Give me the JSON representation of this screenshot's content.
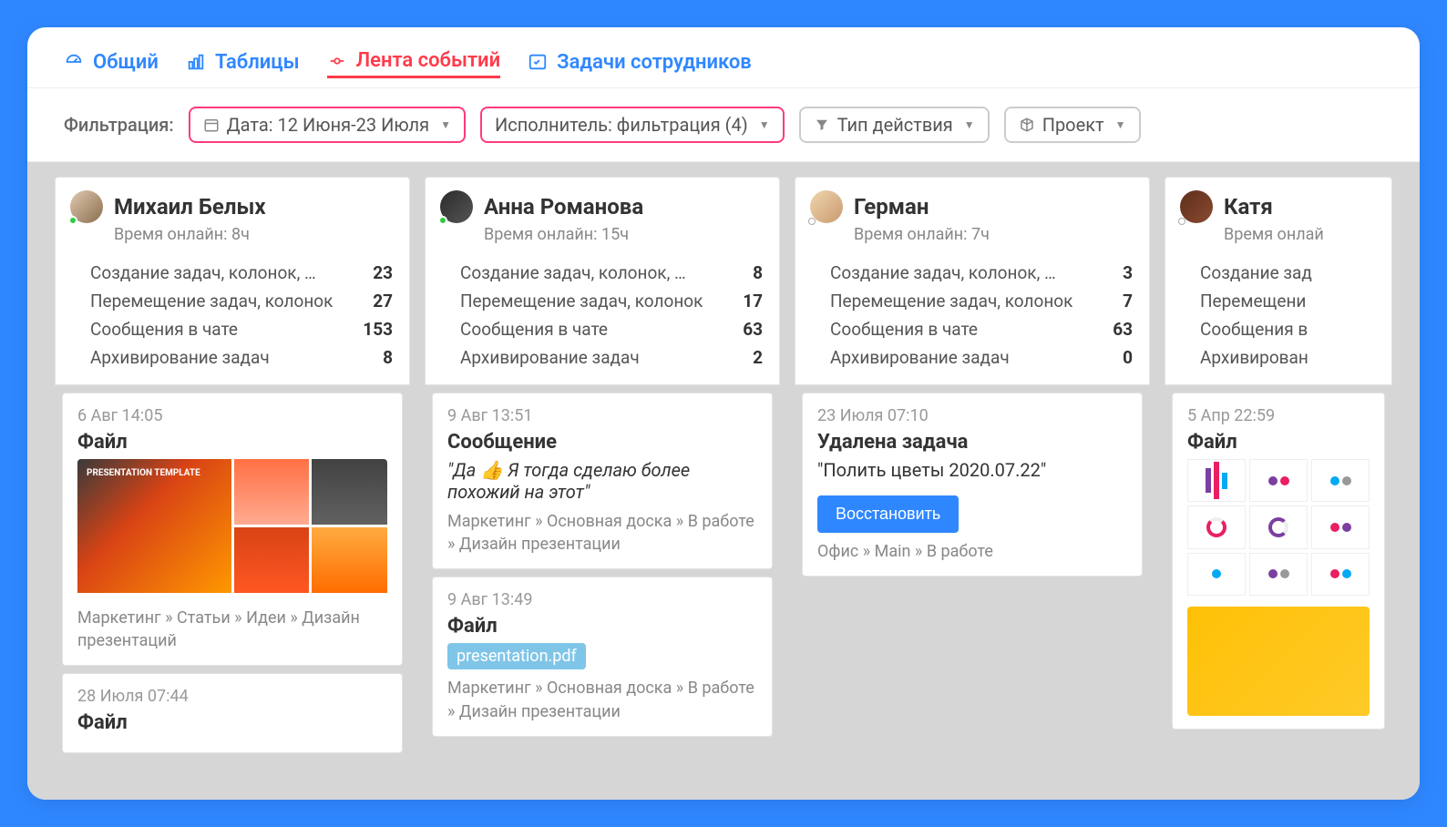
{
  "tabs": {
    "general": "Общий",
    "tables": "Таблицы",
    "feed": "Лента событий",
    "tasks": "Задачи сотрудников"
  },
  "filter": {
    "label": "Фильтрация:",
    "date": "Дата: 12 Июня-23 Июля",
    "assignee": "Исполнитель: фильтрация (4)",
    "action_type": "Тип действия",
    "project": "Проект"
  },
  "columns": [
    {
      "name": "Михаил Белых",
      "online": "Время онлайн: 8ч",
      "status": "online",
      "stats": [
        {
          "label": "Создание задач, колонок, …",
          "value": "23"
        },
        {
          "label": "Перемещение задач, колонок",
          "value": "27"
        },
        {
          "label": "Сообщения в чате",
          "value": "153"
        },
        {
          "label": "Архивирование задач",
          "value": "8"
        }
      ],
      "cards": [
        {
          "time": "6 Авг 14:05",
          "title": "Файл",
          "thumb": "orange",
          "path": "Маркетинг » Статьи » Идеи » Дизайн презентаций"
        },
        {
          "time": "28 Июля 07:44",
          "title": "Файл"
        }
      ]
    },
    {
      "name": "Анна Романова",
      "online": "Время онлайн: 15ч",
      "status": "online",
      "stats": [
        {
          "label": "Создание задач, колонок, …",
          "value": "8"
        },
        {
          "label": "Перемещение задач, колонок",
          "value": "17"
        },
        {
          "label": "Сообщения в чате",
          "value": "63"
        },
        {
          "label": "Архивирование задач",
          "value": "2"
        }
      ],
      "cards": [
        {
          "time": "9 Авг 13:51",
          "title": "Сообщение",
          "quote": "\"Да 👍  Я тогда сделаю более похожий на этот\"",
          "path": "Маркетинг » Основная доска » В работе » Дизайн презентации"
        },
        {
          "time": "9 Авг 13:49",
          "title": "Файл",
          "chip": "presentation.pdf",
          "path": "Маркетинг » Основная доска » В работе » Дизайн презентации"
        }
      ]
    },
    {
      "name": "Герман",
      "online": "Время онлайн: 7ч",
      "status": "offline",
      "stats": [
        {
          "label": "Создание задач, колонок, …",
          "value": "3"
        },
        {
          "label": "Перемещение задач, колонок",
          "value": "7"
        },
        {
          "label": "Сообщения в чате",
          "value": "63"
        },
        {
          "label": "Архивирование задач",
          "value": "0"
        }
      ],
      "cards": [
        {
          "time": "23 Июля 07:10",
          "title": "Удалена задача",
          "quote": "\"Полить цветы 2020.07.22\"",
          "button": "Восстановить",
          "path": "Офис » Main » В работе"
        }
      ]
    },
    {
      "name": "Катя",
      "online": "Время онлай",
      "status": "offline",
      "stats": [
        {
          "label": "Создание зад",
          "value": ""
        },
        {
          "label": "Перемещени",
          "value": ""
        },
        {
          "label": "Сообщения в",
          "value": ""
        },
        {
          "label": "Архивирован",
          "value": ""
        }
      ],
      "cards": [
        {
          "time": "5 Апр 22:59",
          "title": "Файл",
          "thumb": "infographic"
        }
      ]
    }
  ]
}
